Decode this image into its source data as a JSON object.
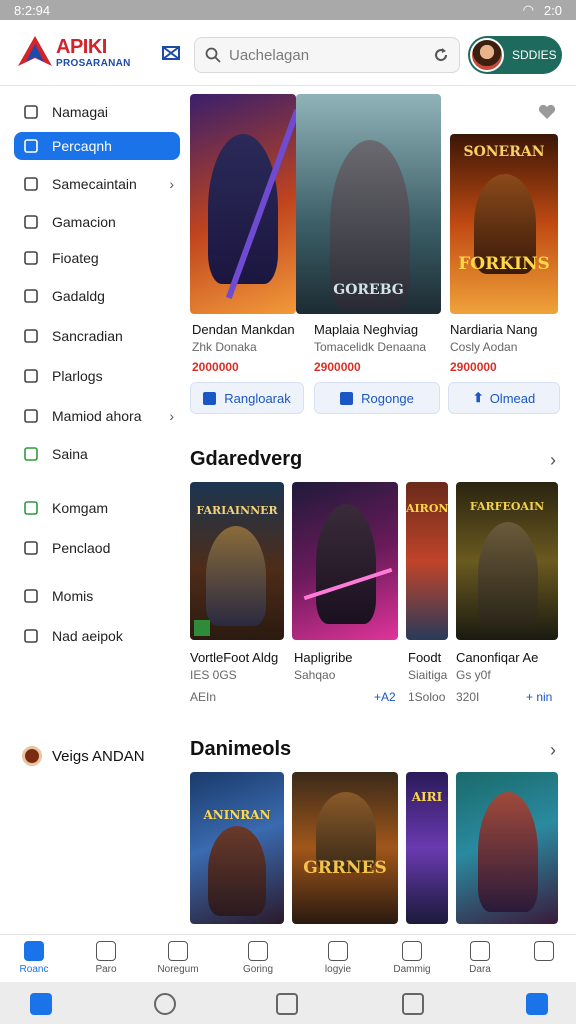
{
  "status_bar": {
    "time": "8:2:94",
    "battery": "2:0"
  },
  "header": {
    "logo_line1": "APIKI",
    "logo_line2": "PROSARANAN",
    "search_placeholder": "Uachelagan",
    "profile_button": "SDDIES"
  },
  "sidebar": {
    "items": [
      {
        "label": "Namagai",
        "icon": "search-icon",
        "active": false,
        "chevron": false
      },
      {
        "label": "Percaqnh",
        "icon": "document-icon",
        "active": true,
        "chevron": false
      },
      {
        "label": "Samecaintain",
        "icon": "controller-icon",
        "active": false,
        "chevron": true
      },
      {
        "label": "Gamacion",
        "icon": "tag-icon",
        "active": false,
        "chevron": false
      },
      {
        "label": "Fioateg",
        "icon": "square-icon",
        "active": false,
        "chevron": false
      },
      {
        "label": "Gadaldg",
        "icon": "list-icon",
        "active": false,
        "chevron": false
      },
      {
        "label": "Sancradian",
        "icon": "info-icon",
        "active": false,
        "chevron": false
      },
      {
        "label": "Plarlogs",
        "icon": "pin-icon",
        "active": false,
        "chevron": false
      },
      {
        "label": "Mamiod ahora",
        "icon": "circle-icon",
        "active": false,
        "chevron": true
      },
      {
        "label": "Saina",
        "icon": "check-icon",
        "active": false,
        "chevron": false
      },
      {
        "label": "Komgam",
        "icon": "check-icon",
        "active": false,
        "chevron": false
      },
      {
        "label": "Penclaod",
        "icon": "circle-dot-icon",
        "active": false,
        "chevron": false
      },
      {
        "label": "Momis",
        "icon": "compass-icon",
        "active": false,
        "chevron": false
      },
      {
        "label": "Nad aeipok",
        "icon": "circle-dot-icon",
        "active": false,
        "chevron": false
      }
    ],
    "bottom_label": "Veigs ANDAN"
  },
  "featured": {
    "cards": [
      {
        "title": "Dendan Mankdan",
        "sub": "Zhk Donaka",
        "price": "2000000"
      },
      {
        "title": "Maplaia Neghviag",
        "sub": "Tomacelidk Denaana",
        "price": "2900000"
      },
      {
        "title": "Nardiaria Nang",
        "sub": "Cosly Aodan",
        "price": "2900000"
      }
    ],
    "art_label_mid": "GOREBG",
    "art_label_right_top": "SONERAN",
    "art_label_right_bottom": "FORKINS",
    "buttons": [
      {
        "label": "Rangloarak"
      },
      {
        "label": "Rogonge"
      },
      {
        "label": "Olmead"
      }
    ]
  },
  "section1": {
    "title": "Gdaredverg",
    "cards": [
      {
        "title": "VortleFoot Aldg",
        "sub": "IES 0GS",
        "meta": "AEIn",
        "art": "FARIAINNER"
      },
      {
        "title": "Hapligribe",
        "sub": "Sahqao",
        "meta": "+A2",
        "art": ""
      },
      {
        "title": "Foodt",
        "sub": "Siaitiga",
        "meta": "1Soloo",
        "art": "AIRON"
      },
      {
        "title": "Canonfiqar Ae",
        "sub": "Gs y0f",
        "meta": "320I",
        "art": "FARFEOAIN"
      }
    ],
    "trailing_meta": "+ nin"
  },
  "section2": {
    "title": "Danimeols",
    "cards": [
      {
        "title": "",
        "art": "ANINRAN"
      },
      {
        "title": "",
        "art": "GRRNES"
      },
      {
        "title": "",
        "art": "AIRI"
      },
      {
        "title": "",
        "art": ""
      }
    ]
  },
  "bottom_nav": {
    "items": [
      {
        "label": "Roanc",
        "active": true
      },
      {
        "label": "Paro",
        "active": false
      },
      {
        "label": "Noregum",
        "active": false
      },
      {
        "label": "Goring",
        "active": false
      },
      {
        "label": "logyie",
        "active": false
      },
      {
        "label": "Dammig",
        "active": false
      },
      {
        "label": "Dara",
        "active": false
      },
      {
        "label": "",
        "active": false
      }
    ]
  },
  "colors": {
    "accent": "#1a73e8",
    "profile_button": "#1e6b5e",
    "price": "#d93025",
    "logo_red": "#d3232b",
    "logo_blue": "#1e4aa8"
  }
}
